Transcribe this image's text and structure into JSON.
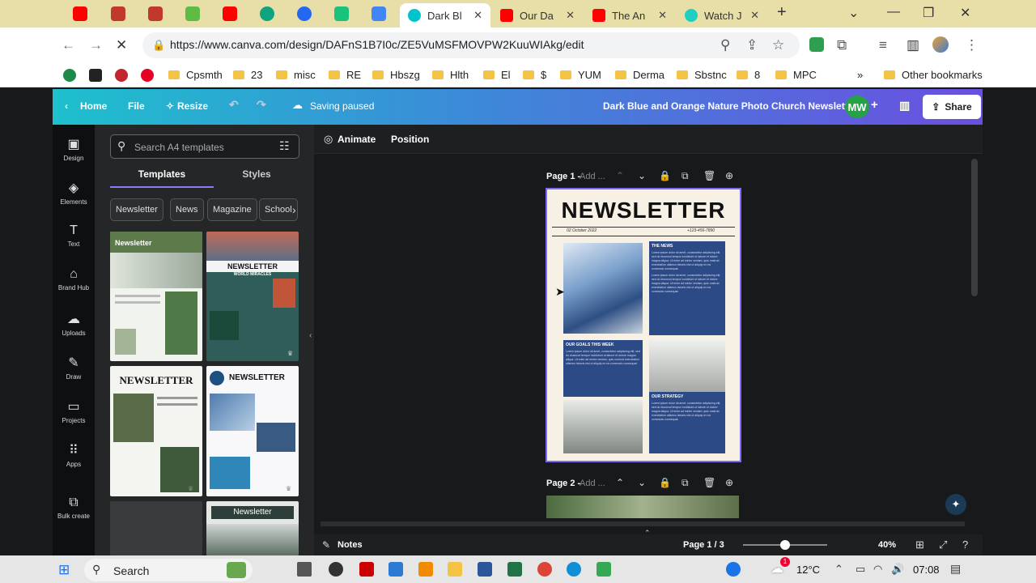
{
  "browser": {
    "tabs": [
      {
        "label": "Dark Bl",
        "color": "#00c4cc",
        "active": true
      },
      {
        "label": "Our Da",
        "color": "#ff0000"
      },
      {
        "label": "The An",
        "color": "#ff0000"
      },
      {
        "label": "Watch J",
        "color": "#1fcfc1"
      }
    ],
    "url": "https://www.canva.com/design/DAFnS1B7I0c/ZE5VuMSFMOVPW2KuuWIAkg/edit",
    "bookmarks": [
      "Cpsmth",
      "23",
      "misc",
      "RE",
      "Hbszg",
      "Hlth",
      "El",
      "$",
      "YUM",
      "Derma",
      "Sbstnc",
      "8",
      "MPC"
    ],
    "other_bookmarks": "Other bookmarks",
    "overflow": "»"
  },
  "canva_header": {
    "home": "Home",
    "file": "File",
    "resize": "Resize",
    "status": "Saving paused",
    "design_title": "Dark Blue and Orange Nature Photo Church Newsletter",
    "avatar_initials": "MW",
    "share": "Share"
  },
  "rail": [
    "Design",
    "Elements",
    "Text",
    "Brand Hub",
    "Uploads",
    "Draw",
    "Projects",
    "Apps",
    "Bulk create"
  ],
  "panel": {
    "search_placeholder": "Search A4 templates",
    "tab_templates": "Templates",
    "tab_styles": "Styles",
    "chips": [
      "Newsletter",
      "News",
      "Magazine",
      "School"
    ],
    "templates": [
      {
        "title": "Newsletter"
      },
      {
        "title": "NEWSLETTER",
        "subtitle": "WORLD MIRACLES"
      },
      {
        "title": "NEWSLETTER"
      },
      {
        "title": "NEWSLETTER"
      },
      {
        "title": ""
      },
      {
        "title": "Newsletter"
      }
    ]
  },
  "editor": {
    "animate": "Animate",
    "position": "Position",
    "page1_label": "Page 1 -",
    "page1_add": "Add ...",
    "page2_label": "Page 2 -",
    "page2_add": "Add ...",
    "newsletter_title": "NEWSLETTER",
    "date": "02 October 2022",
    "phone": "+123-456-7890",
    "box_news": "THE NEWS",
    "box_goals": "OUR GOALS THIS WEEK",
    "box_strategy": "OUR STRATEGY",
    "lorem": "Lorem ipsum dolor sit amet, consectetur adipiscing elit, sed do eiusmod tempor incididunt ut labore et dolore magna aliqua. Ut enim ad minim veniam, quis nostrud exercitation ullamco laboris nisi ut aliquip ex ea commodo consequat."
  },
  "bottom_bar": {
    "notes": "Notes",
    "page_count": "Page 1 / 3",
    "zoom": "40%",
    "zoom_level": 0.5
  },
  "taskbar": {
    "search": "Search",
    "temperature": "12°C",
    "time": "07:08",
    "notif_count": "1"
  },
  "colors": {
    "accent": "#7c6af5",
    "newsletter_blue": "#2b4a86",
    "cream": "#f6f1e4"
  }
}
